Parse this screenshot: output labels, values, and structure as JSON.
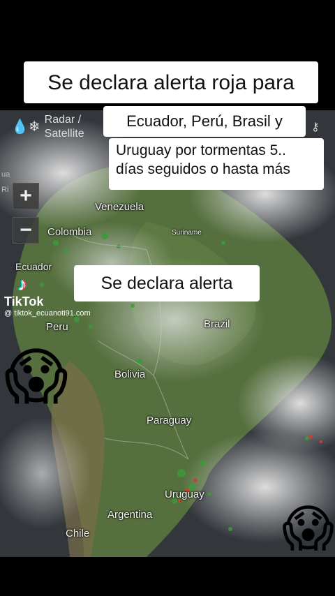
{
  "captions": {
    "top": "Se declara alerta roja para",
    "line2": "Ecuador, Perú,  Brasil y",
    "line3": "Uruguay por tormentas 5.. días seguidos o hasta más",
    "middle": "Se declara alerta"
  },
  "map_ui": {
    "radar_label_1": "Radar /",
    "radar_label_2": "Satellite",
    "zoom_in": "+",
    "zoom_out": "−",
    "edge_text_1": "ua",
    "edge_text_2": "Ri"
  },
  "countries": {
    "venezuela": "Venezuela",
    "colombia": "Colombia",
    "suriname": "Suriname",
    "ecuador": "Ecuador",
    "peru": "Peru",
    "brazil": "Brazil",
    "bolivia": "Bolivia",
    "paraguay": "Paraguay",
    "uruguay": "Uruguay",
    "argentina": "Argentina",
    "chile": "Chile"
  },
  "watermark": {
    "brand": "TikTok",
    "handle": "@ tiktok_ecuanoti91.com"
  },
  "emoji": {
    "scream": "😱"
  },
  "colors": {
    "ocean": "#2f3338",
    "land": "#4f6a3a",
    "clouds": "#d8d8d8",
    "precip_light": "#3c9a3c",
    "precip_heavy": "#d9382c"
  }
}
